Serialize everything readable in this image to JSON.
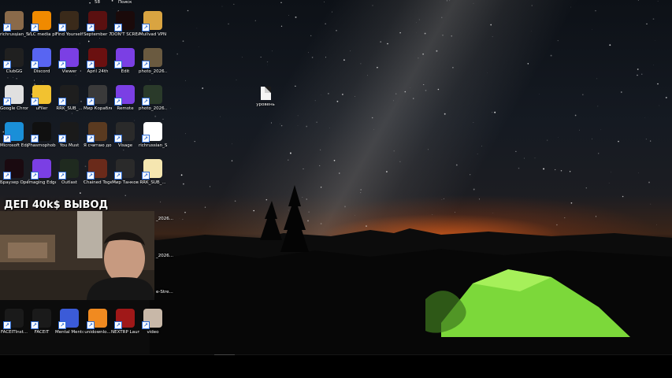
{
  "top_labels": [
    {
      "text": "58"
    },
    {
      "text": "Поиск"
    }
  ],
  "desktop_icons": [
    {
      "label": "richrussian_Stream - ...",
      "icon": "image-file-icon",
      "color": "#8a6a4a"
    },
    {
      "label": "VLC media player",
      "icon": "vlc-icon",
      "color": "#f08a00"
    },
    {
      "label": "Find Yourself",
      "icon": "game-icon",
      "color": "#3a2a1a"
    },
    {
      "label": "September 7th",
      "icon": "game-icon",
      "color": "#5a1010"
    },
    {
      "label": "DON'T SCREAM",
      "icon": "game-icon",
      "color": "#1a0a0a"
    },
    {
      "label": "Mullvad VPN",
      "icon": "mullvad-icon",
      "color": "#d9a441"
    },
    {
      "label": "ClubGG",
      "icon": "clubgg-icon",
      "color": "#202020"
    },
    {
      "label": "Discord",
      "icon": "discord-icon",
      "color": "#5865f2"
    },
    {
      "label": "Viewer",
      "icon": "iedt-icon",
      "color": "#7b3fe4"
    },
    {
      "label": "April 24th",
      "icon": "game-icon",
      "color": "#6a1010"
    },
    {
      "label": "Edit",
      "icon": "iedt-icon",
      "color": "#7b3fe4"
    },
    {
      "label": "photo_2026...",
      "icon": "image-file-icon",
      "color": "#6a5a40"
    },
    {
      "label": "Google Chrome",
      "icon": "chrome-icon",
      "color": "#e0e0e0"
    },
    {
      "label": "uFiler",
      "icon": "folder-icon",
      "color": "#f2c230"
    },
    {
      "label": "RRK_SUB_...",
      "icon": "figma-icon",
      "color": "#1e1e1e"
    },
    {
      "label": "Мир Кораблей",
      "icon": "shield-icon",
      "color": "#3a3a3a"
    },
    {
      "label": "Remote",
      "icon": "iedt-icon",
      "color": "#7b3fe4"
    },
    {
      "label": "photo_2026...",
      "icon": "image-file-icon",
      "color": "#2a3a2a"
    },
    {
      "label": "Microsoft Edge",
      "icon": "edge-icon",
      "color": "#1a8fd8"
    },
    {
      "label": "Phasmophobia",
      "icon": "game-icon",
      "color": "#101010"
    },
    {
      "label": "You Must",
      "icon": "game-icon",
      "color": "#1a1a1a"
    },
    {
      "label": "Я считаю до 6...",
      "icon": "game-icon",
      "color": "#5a3a20"
    },
    {
      "label": "Visage",
      "icon": "game-icon",
      "color": "#2a2a2a"
    },
    {
      "label": "richrussian_Stream - ...",
      "icon": "image-file-icon",
      "color": "#ffffff"
    },
    {
      "label": "Браузер Opera GX",
      "icon": "opera-icon",
      "color": "#1a0a10"
    },
    {
      "label": "Imaging Edge Desktop",
      "icon": "iedt-icon",
      "color": "#7b3fe4"
    },
    {
      "label": "Outlast",
      "icon": "game-icon",
      "color": "#1f2a1f"
    },
    {
      "label": "Chained Together",
      "icon": "game-icon",
      "color": "#6a2a1a"
    },
    {
      "label": "Мир Танков",
      "icon": "shield-icon",
      "color": "#2a2a2a"
    },
    {
      "label": "RRK_SUB_...",
      "icon": "folder-icon",
      "color": "#f5e6b0"
    },
    {
      "label": "FACEITInst...",
      "icon": "faceit-icon",
      "color": "#1a1a1a"
    },
    {
      "label": "FACEIT",
      "icon": "faceit-icon",
      "color": "#1a1a1a"
    },
    {
      "label": "Mental Mentor",
      "icon": "app-icon",
      "color": "#3b5bd8"
    },
    {
      "label": "unidownlo...",
      "icon": "download-icon",
      "color": "#f08a20"
    },
    {
      "label": "NEXTRP Launcher",
      "icon": "game-icon",
      "color": "#a01818"
    },
    {
      "label": "video",
      "icon": "video-file-icon",
      "color": "#c8b8a8"
    }
  ],
  "partial_labels": [
    "_2026...",
    "_2026...",
    "e-Stre..."
  ],
  "stream_banner": "ДЕП 40k$ ВЫВОД",
  "desktop_file": {
    "label": "уровень",
    "icon": "document-icon"
  }
}
